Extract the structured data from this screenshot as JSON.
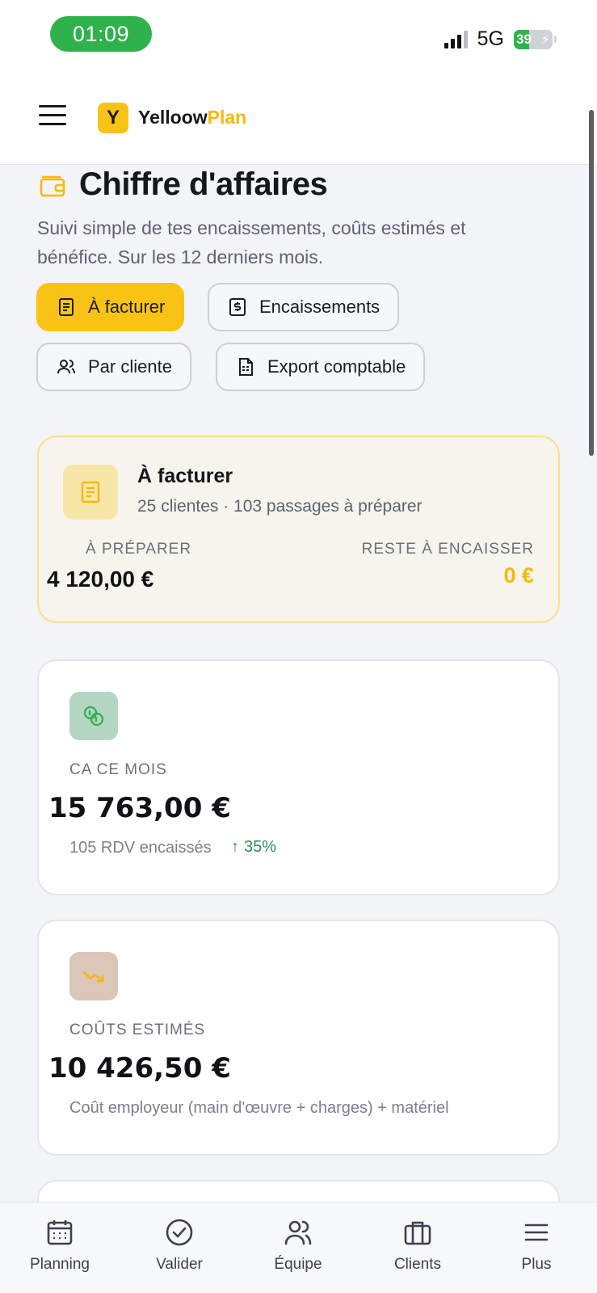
{
  "status_bar": {
    "time": "01:09",
    "network": "5G",
    "battery_level": "39",
    "battery_fraction": 0.39
  },
  "app": {
    "logo_letter": "Y",
    "brand_part1": "Yelloow",
    "brand_part2": "Plan",
    "accent_color": "#f9c316"
  },
  "page": {
    "title": "Chiffre d'affaires",
    "subtitle": "Suivi simple de tes encaissements, coûts estimés et bénéfice. Sur les 12 derniers mois."
  },
  "filters": [
    {
      "label": "À facturer",
      "icon": "receipt-icon",
      "active": true
    },
    {
      "label": "Encaissements",
      "icon": "dollar-receipt-icon",
      "active": false
    },
    {
      "label": "Par cliente",
      "icon": "users-icon",
      "active": false
    },
    {
      "label": "Export comptable",
      "icon": "document-icon",
      "active": false
    }
  ],
  "to_invoice": {
    "title": "À facturer",
    "summary": "25 clientes · 103 passages à préparer",
    "prepare_label": "À PRÉPARER",
    "prepare_value": "4 120,00 €",
    "remaining_label": "RESTE À ENCAISSER",
    "remaining_value": "0 €"
  },
  "revenue": {
    "label": "CA CE MOIS",
    "value": "15 763,00 €",
    "detail": "105 RDV encaissés",
    "trend": "35%",
    "trend_color": "#2e8b57"
  },
  "costs": {
    "label": "COÛTS ESTIMÉS",
    "value": "10 426,50 €",
    "detail": "Coût employeur (main d'œuvre + charges) + matériel"
  },
  "bottom_nav": [
    {
      "label": "Planning",
      "icon": "calendar-icon"
    },
    {
      "label": "Valider",
      "icon": "check-circle-icon"
    },
    {
      "label": "Équipe",
      "icon": "team-icon"
    },
    {
      "label": "Clients",
      "icon": "briefcase-icon"
    },
    {
      "label": "Plus",
      "icon": "menu-icon"
    }
  ]
}
